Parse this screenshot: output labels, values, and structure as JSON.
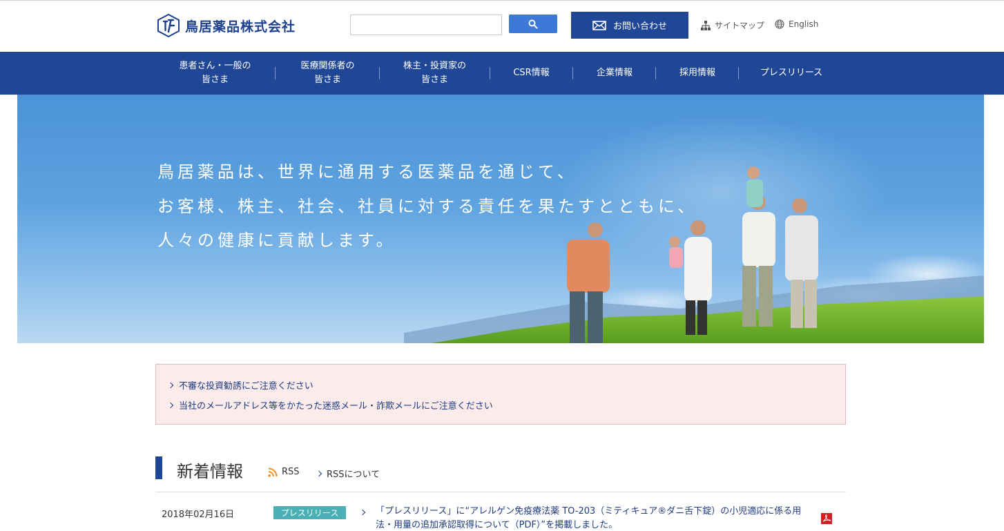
{
  "header": {
    "logo_text": "鳥居薬品株式会社",
    "search": {
      "value": "",
      "placeholder": ""
    },
    "contact_label": "お問い合わせ",
    "sitemap_label": "サイトマップ",
    "english_label": "English"
  },
  "nav": {
    "items": [
      {
        "line1": "患者さん・一般の",
        "line2": "皆さま"
      },
      {
        "line1": "医療関係者の",
        "line2": "皆さま"
      },
      {
        "line1": "株主・投資家の",
        "line2": "皆さま"
      },
      {
        "line1": "CSR情報",
        "line2": ""
      },
      {
        "line1": "企業情報",
        "line2": ""
      },
      {
        "line1": "採用情報",
        "line2": ""
      },
      {
        "line1": "プレスリリース",
        "line2": ""
      }
    ]
  },
  "hero": {
    "lines": [
      "鳥居薬品は、世界に通用する医薬品を通じて、",
      "お客様、株主、社会、社員に対する責任を果たすとともに、",
      "人々の健康に貢献します。"
    ]
  },
  "notices": [
    "不審な投資勧誘にご注意ください",
    "当社のメールアドレス等をかたった迷惑メール・詐欺メールにご注意ください"
  ],
  "news": {
    "title": "新着情報",
    "rss_label": "RSS",
    "rss_about_label": "RSSについて",
    "items": [
      {
        "date": "2018年02月16日",
        "category": "プレスリリース",
        "text": "「プレスリリース」に“アレルゲン免疫療法薬 TO-203（ミティキュア®ダニ舌下錠）の小児適応に係る用法・用量の追加承認取得について（PDF）”を掲載しました。"
      }
    ]
  },
  "colors": {
    "brand_navy": "#1f4796",
    "search_blue": "#3d7ad8",
    "notice_bg": "#fbeceb",
    "category_teal": "#4bb0b6",
    "rss_orange": "#f39020",
    "pdf_red": "#d21f1f"
  }
}
